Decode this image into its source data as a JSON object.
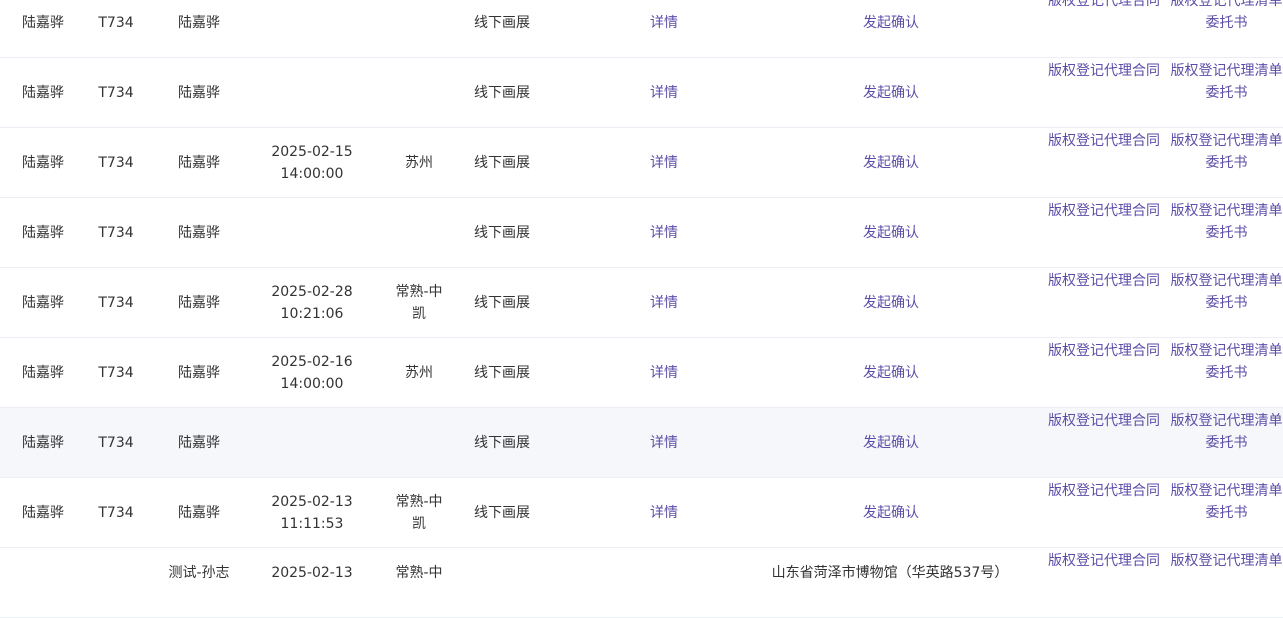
{
  "table": {
    "rows": [
      {
        "name": "陆嘉骅",
        "code": "T734",
        "agent": "陆嘉骅",
        "time": "",
        "city": "",
        "type": "线下画展",
        "detail": "详情",
        "action": "发起确认",
        "link1": "版权登记代理合同",
        "link2": "版权登记代理清单委托书",
        "hover": false
      },
      {
        "name": "陆嘉骅",
        "code": "T734",
        "agent": "陆嘉骅",
        "time": "",
        "city": "",
        "type": "线下画展",
        "detail": "详情",
        "action": "发起确认",
        "link1": "版权登记代理合同",
        "link2": "版权登记代理清单委托书",
        "hover": false
      },
      {
        "name": "陆嘉骅",
        "code": "T734",
        "agent": "陆嘉骅",
        "time": "2025-02-15\n14:00:00",
        "city": "苏州",
        "type": "线下画展",
        "detail": "详情",
        "action": "发起确认",
        "link1": "版权登记代理合同",
        "link2": "版权登记代理清单委托书",
        "hover": false
      },
      {
        "name": "陆嘉骅",
        "code": "T734",
        "agent": "陆嘉骅",
        "time": "",
        "city": "",
        "type": "线下画展",
        "detail": "详情",
        "action": "发起确认",
        "link1": "版权登记代理合同",
        "link2": "版权登记代理清单委托书",
        "hover": false
      },
      {
        "name": "陆嘉骅",
        "code": "T734",
        "agent": "陆嘉骅",
        "time": "2025-02-28\n10:21:06",
        "city": "常熟-中凯",
        "type": "线下画展",
        "detail": "详情",
        "action": "发起确认",
        "link1": "版权登记代理合同",
        "link2": "版权登记代理清单委托书",
        "hover": false
      },
      {
        "name": "陆嘉骅",
        "code": "T734",
        "agent": "陆嘉骅",
        "time": "2025-02-16\n14:00:00",
        "city": "苏州",
        "type": "线下画展",
        "detail": "详情",
        "action": "发起确认",
        "link1": "版权登记代理合同",
        "link2": "版权登记代理清单委托书",
        "hover": false
      },
      {
        "name": "陆嘉骅",
        "code": "T734",
        "agent": "陆嘉骅",
        "time": "",
        "city": "",
        "type": "线下画展",
        "detail": "详情",
        "action": "发起确认",
        "link1": "版权登记代理合同",
        "link2": "版权登记代理清单委托书",
        "hover": true
      },
      {
        "name": "陆嘉骅",
        "code": "T734",
        "agent": "陆嘉骅",
        "time": "2025-02-13\n11:11:53",
        "city": "常熟-中凯",
        "type": "线下画展",
        "detail": "详情",
        "action": "发起确认",
        "link1": "版权登记代理合同",
        "link2": "版权登记代理清单委托书",
        "hover": false
      }
    ],
    "partial_row": {
      "agent": "测试-孙志",
      "time": "2025-02-13",
      "city": "常熟-中",
      "address": "山东省菏泽市博物馆（华英路537号）",
      "link1": "版权登记代理合同",
      "link2": "版权登记代理清单"
    }
  },
  "colors": {
    "link": "#5b4ea8",
    "text": "#333333",
    "row_hover": "#f5f7fa",
    "divider": "#ebeef5"
  }
}
